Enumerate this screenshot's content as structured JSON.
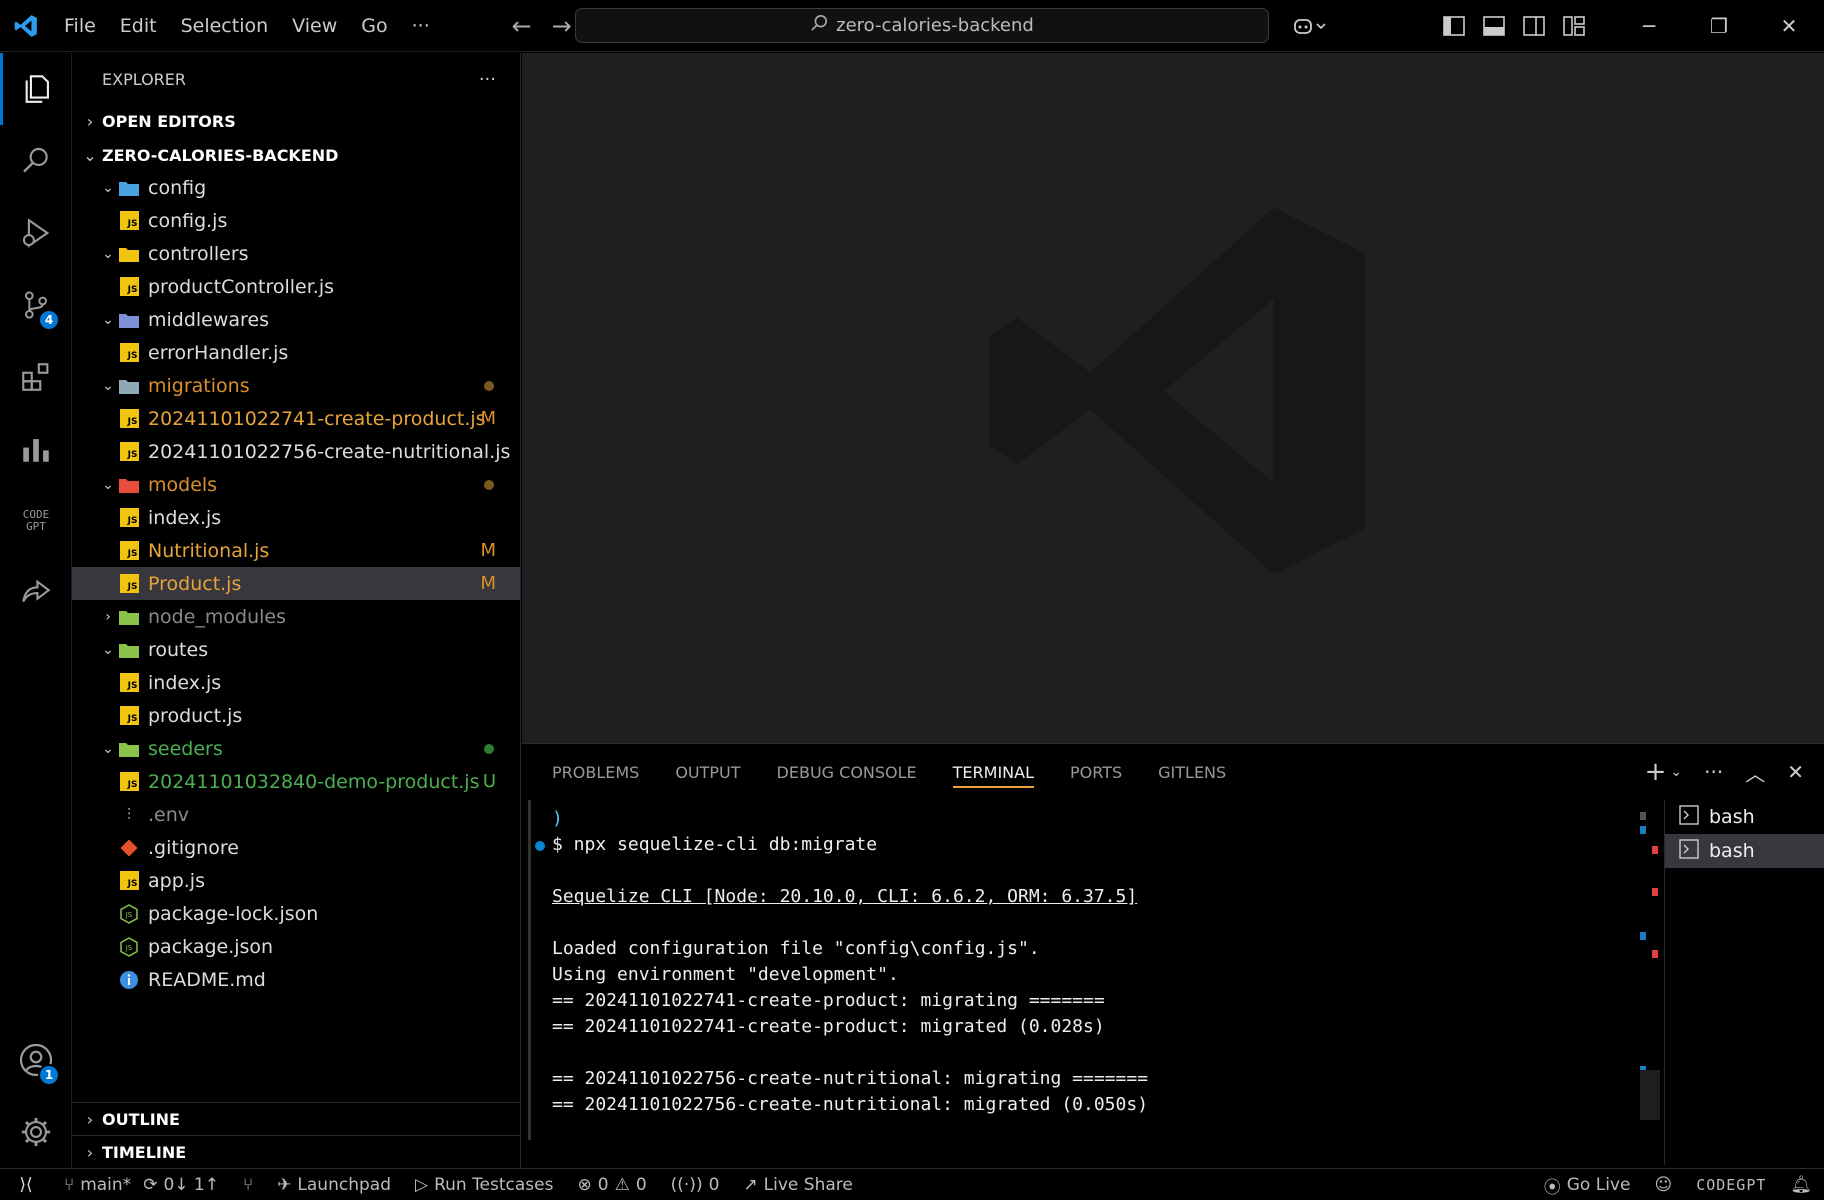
{
  "titlebar": {
    "menus": [
      "File",
      "Edit",
      "Selection",
      "View",
      "Go",
      "···"
    ],
    "search": "zero-calories-backend"
  },
  "activity": {
    "source_control_badge": "4",
    "accounts_badge": "1",
    "codegpt_label": "CODE GPT"
  },
  "explorer": {
    "title": "EXPLORER",
    "more": "···",
    "open_editors": "OPEN EDITORS",
    "root": "ZERO-CALORIES-BACKEND",
    "items": [
      {
        "name": "config",
        "depth": 0,
        "type": "folder",
        "open": true,
        "icon_color": "#4aa3df"
      },
      {
        "name": "config.js",
        "depth": 1,
        "type": "js"
      },
      {
        "name": "controllers",
        "depth": 0,
        "type": "folder",
        "open": true,
        "icon_color": "#f1c40f"
      },
      {
        "name": "productController.js",
        "depth": 1,
        "type": "js"
      },
      {
        "name": "middlewares",
        "depth": 0,
        "type": "folder",
        "open": true,
        "icon_color": "#7f8fd6"
      },
      {
        "name": "errorHandler.js",
        "depth": 1,
        "type": "js"
      },
      {
        "name": "migrations",
        "depth": 0,
        "type": "folder",
        "open": true,
        "icon_color": "#8fa8b5",
        "color": "#d9902c",
        "dot": "#7a5a1a"
      },
      {
        "name": "20241101022741-create-product.js",
        "depth": 1,
        "type": "js",
        "color": "#e8a33a",
        "status": "M",
        "status_color": "#d9902c"
      },
      {
        "name": "20241101022756-create-nutritional.js",
        "depth": 1,
        "type": "js"
      },
      {
        "name": "models",
        "depth": 0,
        "type": "folder",
        "open": true,
        "icon_color": "#e74c3c",
        "color": "#d9902c",
        "dot": "#7a5a1a"
      },
      {
        "name": "index.js",
        "depth": 1,
        "type": "js"
      },
      {
        "name": "Nutritional.js",
        "depth": 1,
        "type": "js",
        "color": "#e8a33a",
        "status": "M",
        "status_color": "#d9902c"
      },
      {
        "name": "Product.js",
        "depth": 1,
        "type": "js",
        "color": "#e8a33a",
        "status": "M",
        "status_color": "#d9902c",
        "selected": true
      },
      {
        "name": "node_modules",
        "depth": 0,
        "type": "folder",
        "open": false,
        "icon_color": "#8bc34a",
        "color": "#8a8a8a"
      },
      {
        "name": "routes",
        "depth": 0,
        "type": "folder",
        "open": true,
        "icon_color": "#8bc34a"
      },
      {
        "name": "index.js",
        "depth": 1,
        "type": "js"
      },
      {
        "name": "product.js",
        "depth": 1,
        "type": "js"
      },
      {
        "name": "seeders",
        "depth": 0,
        "type": "folder",
        "open": true,
        "icon_color": "#8bc34a",
        "color": "#4caf50",
        "dot": "#2e7d32"
      },
      {
        "name": "20241101032840-demo-product.js",
        "depth": 1,
        "type": "js",
        "color": "#4caf50",
        "status": "U",
        "status_color": "#4caf50"
      },
      {
        "name": ".env",
        "depth": 0,
        "type": "env",
        "color": "#8a8a8a"
      },
      {
        "name": ".gitignore",
        "depth": 0,
        "type": "git"
      },
      {
        "name": "app.js",
        "depth": 0,
        "type": "js"
      },
      {
        "name": "package-lock.json",
        "depth": 0,
        "type": "node"
      },
      {
        "name": "package.json",
        "depth": 0,
        "type": "node"
      },
      {
        "name": "README.md",
        "depth": 0,
        "type": "info"
      }
    ],
    "outline": "OUTLINE",
    "timeline": "TIMELINE"
  },
  "panel": {
    "tabs": [
      "PROBLEMS",
      "OUTPUT",
      "DEBUG CONSOLE",
      "TERMINAL",
      "PORTS",
      "GITLENS"
    ],
    "active_tab": "TERMINAL",
    "terminal_lines": [
      {
        "text": ")",
        "cls": "cyan"
      },
      {
        "text": "$ npx sequelize-cli db:migrate",
        "dot": true
      },
      {
        "text": ""
      },
      {
        "text": "Sequelize CLI [Node: 20.10.0, CLI: 6.6.2, ORM: 6.37.5]",
        "cls": "u"
      },
      {
        "text": ""
      },
      {
        "text": "Loaded configuration file \"config\\config.js\"."
      },
      {
        "text": "Using environment \"development\"."
      },
      {
        "text": "== 20241101022741-create-product: migrating ======="
      },
      {
        "text": "== 20241101022741-create-product: migrated (0.028s)"
      },
      {
        "text": ""
      },
      {
        "text": "== 20241101022756-create-nutritional: migrating ======="
      },
      {
        "text": "== 20241101022756-create-nutritional: migrated (0.050s)"
      }
    ],
    "terminals": [
      "bash",
      "bash"
    ]
  },
  "statusbar": {
    "branch": "main*",
    "sync": "0↓ 1↑",
    "launchpad": "Launchpad",
    "testcases": "Run Testcases",
    "errors": "0",
    "warnings": "0",
    "ports": "0",
    "liveshare": "Live Share",
    "golive": "Go Live",
    "codegpt": "CODEGPT"
  }
}
